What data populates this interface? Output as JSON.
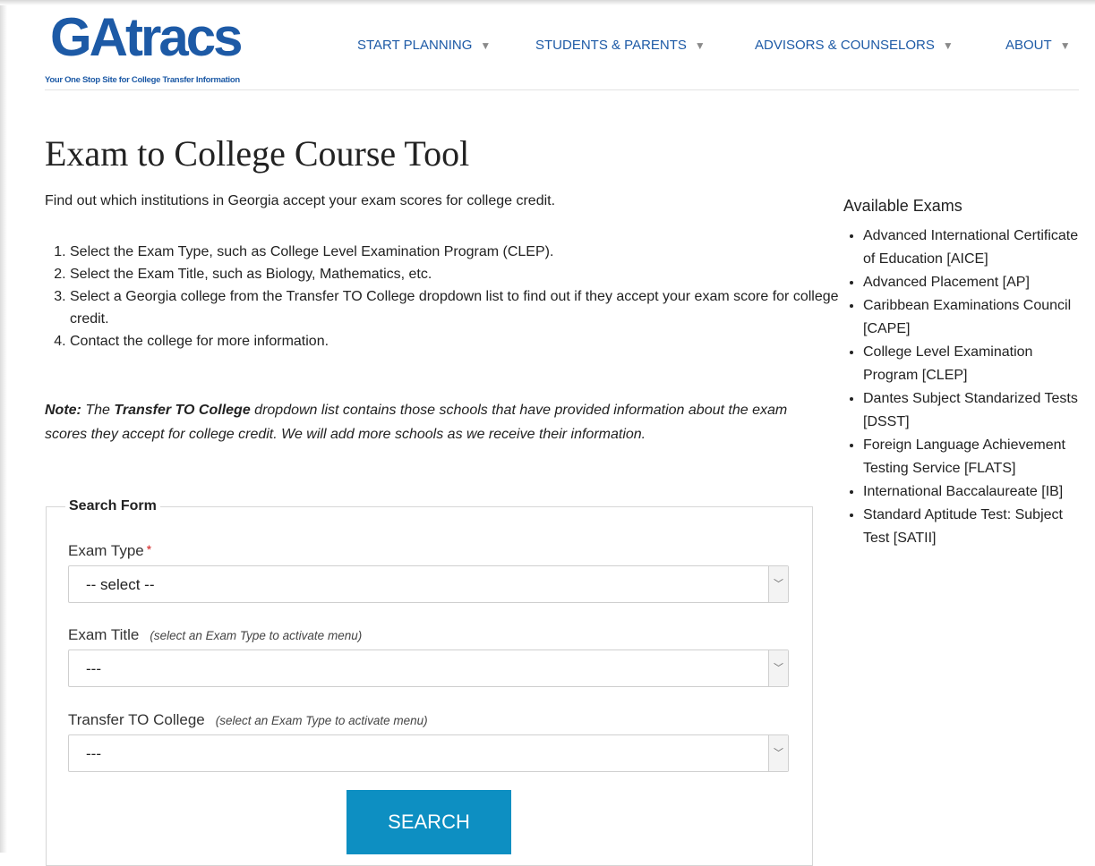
{
  "logo": {
    "word": "GAtracs",
    "tagline": "Your One Stop Site for College Transfer Information"
  },
  "nav": [
    {
      "label": "START PLANNING"
    },
    {
      "label": "STUDENTS & PARENTS"
    },
    {
      "label": "ADVISORS & COUNSELORS"
    },
    {
      "label": "ABOUT"
    }
  ],
  "page": {
    "title": "Exam to College Course Tool",
    "intro": "Find out which institutions in Georgia accept your exam scores for college credit.",
    "steps": [
      "Select the Exam Type, such as College Level Examination Program (CLEP).",
      "Select the Exam Title, such as Biology, Mathematics, etc.",
      "Select a Georgia college from the Transfer TO College dropdown list to find out if they accept your exam score for college credit.",
      "Contact the college for more information."
    ],
    "note": {
      "label": "Note:",
      "pre": "The",
      "bold": "Transfer TO College",
      "post": "dropdown list contains those schools that have provided information about the exam scores they accept for college credit. We will add more schools as we receive their information."
    }
  },
  "form": {
    "legend": "Search Form",
    "exam_type": {
      "label": "Exam Type",
      "required_mark": "*",
      "value": "-- select --"
    },
    "exam_title": {
      "label": "Exam Title",
      "hint": "(select an Exam Type to activate menu)",
      "value": "---"
    },
    "transfer_to": {
      "label": "Transfer TO College",
      "hint": "(select an Exam Type to activate menu)",
      "value": "---"
    },
    "search_label": "SEARCH"
  },
  "sidebar": {
    "title": "Available Exams",
    "items": [
      "Advanced International Certificate of Education [AICE]",
      "Advanced Placement [AP]",
      "Caribbean Examinations Council [CAPE]",
      "College Level Examination Program [CLEP]",
      "Dantes Subject Standarized Tests [DSST]",
      "Foreign Language Achievement Testing Service [FLATS]",
      "International Baccalaureate [IB]",
      "Standard Aptitude Test: Subject Test [SATII]"
    ]
  },
  "colors": {
    "brand": "#1d5aa6",
    "button": "#0d8fc2",
    "required": "#d21b1b"
  },
  "icons": {
    "nav_caret": "chevron-down-icon",
    "select_arrow": "chevron-down-icon"
  }
}
